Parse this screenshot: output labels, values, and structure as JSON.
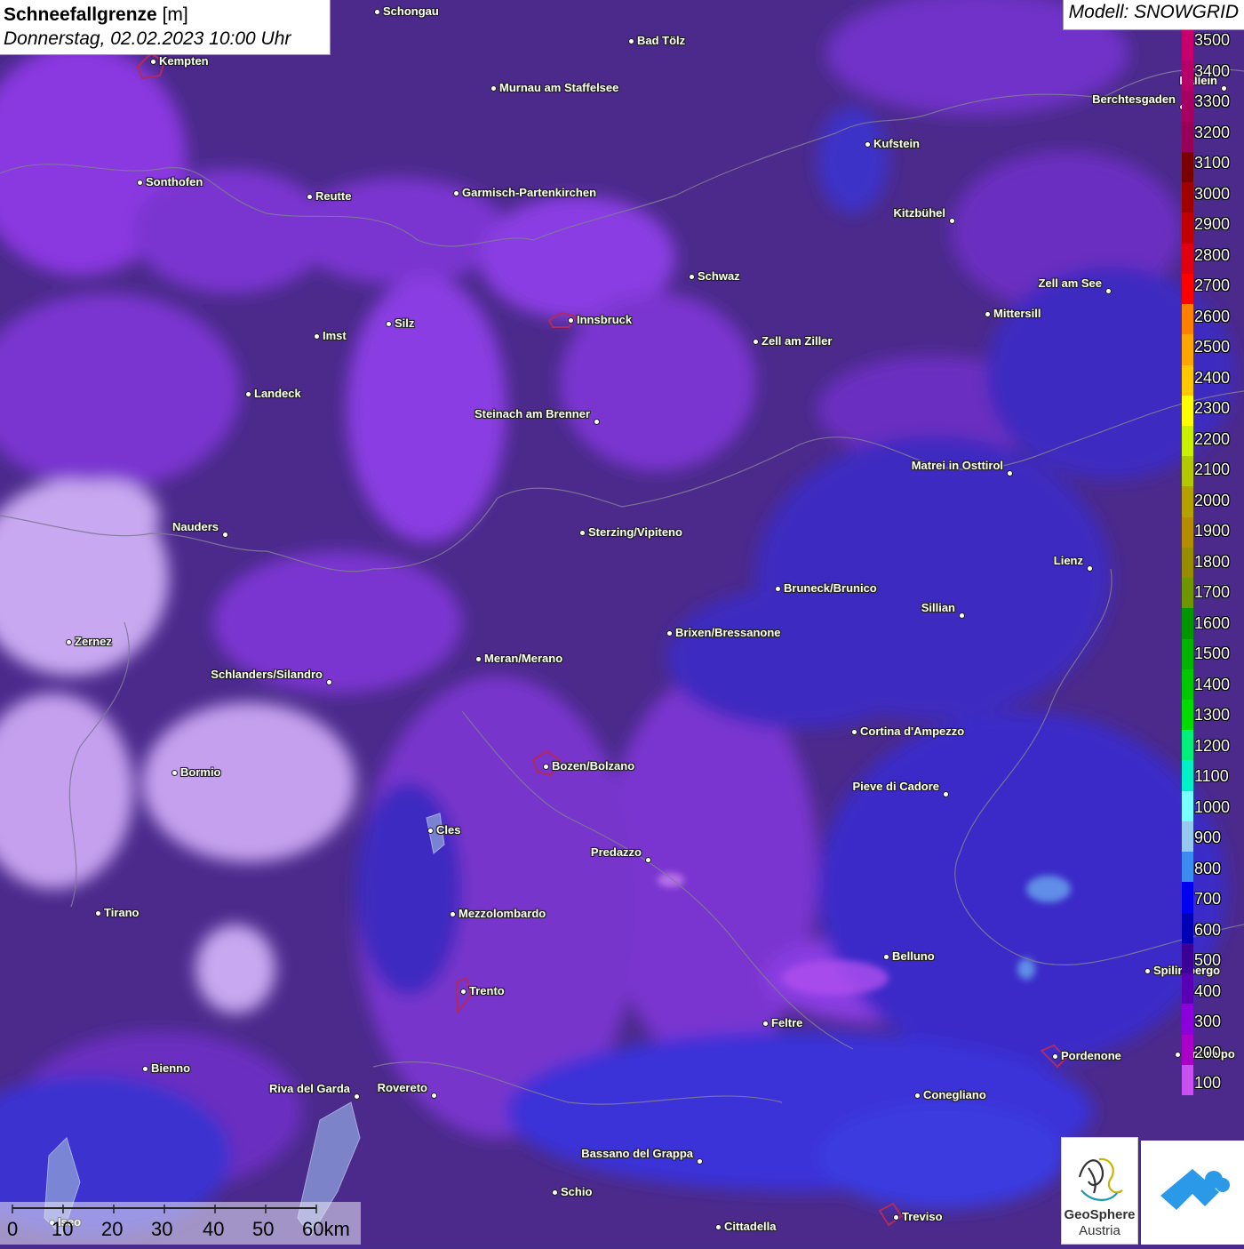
{
  "title": {
    "variable": "Schneefallgrenze",
    "unit": "[m]",
    "datetime": "Donnerstag, 02.02.2023 10:00 Uhr"
  },
  "model": "Modell: SNOWGRID",
  "legend": {
    "labels": [
      "3500",
      "3400",
      "3300",
      "3200",
      "3100",
      "3000",
      "2900",
      "2800",
      "2700",
      "2600",
      "2500",
      "2400",
      "2300",
      "2200",
      "2100",
      "2000",
      "1900",
      "1800",
      "1700",
      "1600",
      "1500",
      "1400",
      "1300",
      "1200",
      "1100",
      "1000",
      "900",
      "800",
      "700",
      "600",
      "500",
      "400",
      "300",
      "200",
      "100"
    ],
    "colors": [
      "#c8006e",
      "#b8006a",
      "#a80062",
      "#980058",
      "#780000",
      "#a00000",
      "#c00000",
      "#e00010",
      "#ff0000",
      "#ff7f00",
      "#ffa500",
      "#ffc800",
      "#ffff00",
      "#c8f000",
      "#b4c800",
      "#b4a000",
      "#b48c00",
      "#968c00",
      "#6e9600",
      "#009600",
      "#00b400",
      "#00c800",
      "#00dc00",
      "#00f07a",
      "#00f0c8",
      "#78ffff",
      "#96c8f0",
      "#3c8cf0",
      "#0000f0",
      "#0000b4",
      "#3c0096",
      "#5a00b4",
      "#8c00dc",
      "#aa00c8",
      "#c850f0"
    ]
  },
  "cities": [
    {
      "name": "Schongau"
    },
    {
      "name": "Bad Tölz"
    },
    {
      "name": "Kempten"
    },
    {
      "name": "Murnau am Staffelsee"
    },
    {
      "name": "Hallein"
    },
    {
      "name": "Berchtesgaden"
    },
    {
      "name": "Kufstein"
    },
    {
      "name": "Sonthofen"
    },
    {
      "name": "Reutte"
    },
    {
      "name": "Garmisch-Partenkirchen"
    },
    {
      "name": "Kitzbühel"
    },
    {
      "name": "Schwaz"
    },
    {
      "name": "Zell am See"
    },
    {
      "name": "Mittersill"
    },
    {
      "name": "Innsbruck"
    },
    {
      "name": "Imst"
    },
    {
      "name": "Silz"
    },
    {
      "name": "Zell am Ziller"
    },
    {
      "name": "Landeck"
    },
    {
      "name": "Steinach am Brenner"
    },
    {
      "name": "Matrei in Osttirol"
    },
    {
      "name": "Nauders"
    },
    {
      "name": "Sterzing/Vipiteno"
    },
    {
      "name": "Lienz"
    },
    {
      "name": "Bruneck/Brunico"
    },
    {
      "name": "Sillian"
    },
    {
      "name": "Brixen/Bressanone"
    },
    {
      "name": "Zernez"
    },
    {
      "name": "Meran/Merano"
    },
    {
      "name": "Schlanders/Silandro"
    },
    {
      "name": "Cortina d'Ampezzo"
    },
    {
      "name": "Bozen/Bolzano"
    },
    {
      "name": "Bormio"
    },
    {
      "name": "Pieve di Cadore"
    },
    {
      "name": "Cles"
    },
    {
      "name": "Predazzo"
    },
    {
      "name": "Tirano"
    },
    {
      "name": "Mezzolombardo"
    },
    {
      "name": "Belluno"
    },
    {
      "name": "Spilimbergo"
    },
    {
      "name": "Trento"
    },
    {
      "name": "Feltre"
    },
    {
      "name": "Pordenone"
    },
    {
      "name": "Codroipo"
    },
    {
      "name": "Bienno"
    },
    {
      "name": "Riva del Garda"
    },
    {
      "name": "Rovereto"
    },
    {
      "name": "Conegliano"
    },
    {
      "name": "Bassano del Grappa"
    },
    {
      "name": "Schio"
    },
    {
      "name": "Iseo"
    },
    {
      "name": "Treviso"
    },
    {
      "name": "Cittadella"
    }
  ],
  "scale": {
    "ticks": [
      "0",
      "10",
      "20",
      "30",
      "40",
      "50",
      "60km"
    ]
  },
  "logos": {
    "geosphere_line1": "GeoSphere",
    "geosphere_line2": "Austria"
  }
}
